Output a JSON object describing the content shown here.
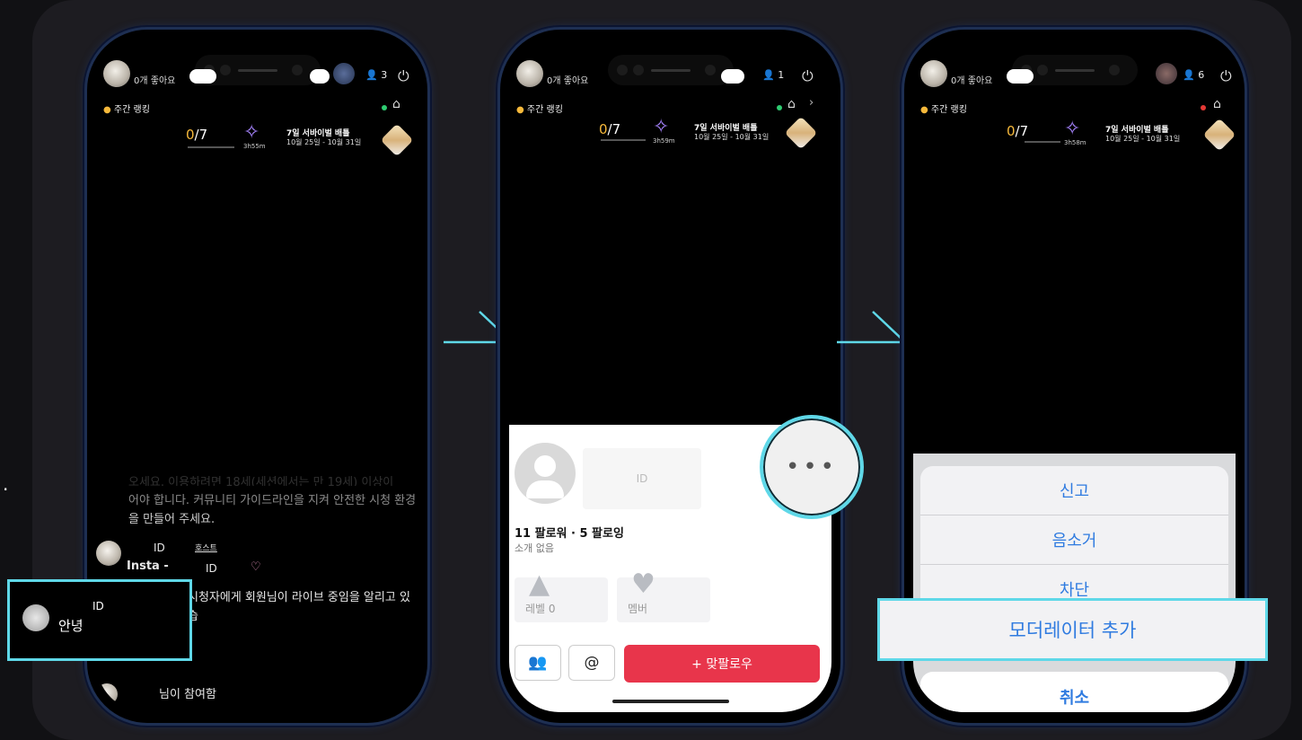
{
  "edge_dot": ".",
  "phone1": {
    "likes": "0개 좋아요",
    "viewer_count": "3",
    "ranking": "주간 랭킹",
    "score_current": "0",
    "score_total": "/7",
    "timer": "3h55m",
    "battle_title": "7일 서바이벌 배틀",
    "battle_date": "10월 25일 - 10월 31일",
    "chat_partial": "오세요. 이용하려면 18세(세션에서는 만 19세) 이상이",
    "chat_line1": "어야 합니다. 커뮤니티 가이드라인을 지켜 안전한 시청 환경",
    "chat_line2": "을 만들어 주세요.",
    "comment_id": "ID",
    "host_label": "호스트",
    "comment_text": "Insta -",
    "comment_id2": "ID",
    "notify_text": "시청자에게 회원님이 라이브 중임을 알리고 있습",
    "highlight_id": "ID",
    "highlight_text": "안녕",
    "join_text": "님이 참여함",
    "status_color": "#2ecc71"
  },
  "phone2": {
    "likes": "0개 좋아요",
    "viewer_count": "1",
    "ranking": "주간 랭킹",
    "score_current": "0",
    "score_total": "/7",
    "timer": "3h59m",
    "battle_title": "7일 서바이벌 배틀",
    "battle_date": "10월 25일 - 10월 31일",
    "profile_id": "ID",
    "follow_counts": "11 팔로워 · 5 팔로잉",
    "intro": "소개 없음",
    "level_label": "레벨 0",
    "member_label": "멤버",
    "follow_back": "+ 맞팔로우",
    "more_dots": "•••",
    "status_color": "#2ecc71"
  },
  "phone3": {
    "likes": "0개 좋아요",
    "viewer_count": "6",
    "ranking": "주간 랭킹",
    "score_current": "0",
    "score_total": "/7",
    "timer": "3h58m",
    "battle_title": "7일 서바이벌 배틀",
    "battle_date": "10월 25일 - 10월 31일",
    "actions": [
      "신고",
      "음소거",
      "차단"
    ],
    "moderator": "모더레이터 추가",
    "cancel": "취소",
    "status_color": "#e53935"
  },
  "accent_color": "#5fd8e8"
}
